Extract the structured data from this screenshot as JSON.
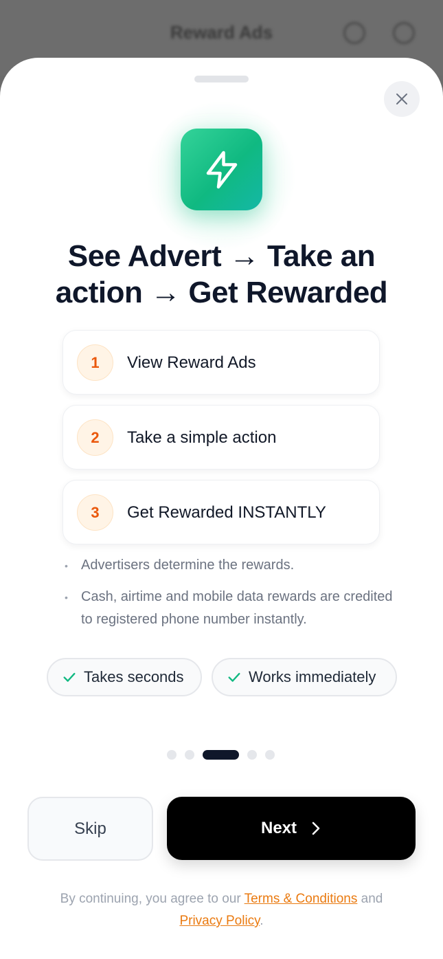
{
  "background": {
    "title": "Reward Ads"
  },
  "hero": {
    "icon": "lightning-bolt-icon",
    "accent": "#10b981"
  },
  "headline": {
    "line1": "See Advert → Take an",
    "line2": "action → Get Rewarded"
  },
  "steps": [
    {
      "number": "1",
      "label": "View Reward Ads"
    },
    {
      "number": "2",
      "label": "Take a simple action"
    },
    {
      "number": "3",
      "label": "Get Rewarded INSTANTLY"
    }
  ],
  "notes": [
    "Advertisers determine the rewards.",
    "Cash, airtime and mobile data rewards are credited to registered phone number instantly."
  ],
  "pills": [
    {
      "label": "Takes seconds",
      "icon": "check-icon"
    },
    {
      "label": "Works immediately",
      "icon": "check-icon"
    }
  ],
  "pagination": {
    "total": 5,
    "current": 3
  },
  "buttons": {
    "skip": "Skip",
    "next": "Next"
  },
  "legal": {
    "prefix": "By continuing, you agree to our",
    "terms": "Terms & Conditions",
    "and": "and",
    "privacy": "Privacy Policy",
    "suffix": "."
  },
  "colors": {
    "step_number": "#ea580c",
    "link": "#ea7a10",
    "check": "#10b981",
    "primary_button": "#000000"
  }
}
